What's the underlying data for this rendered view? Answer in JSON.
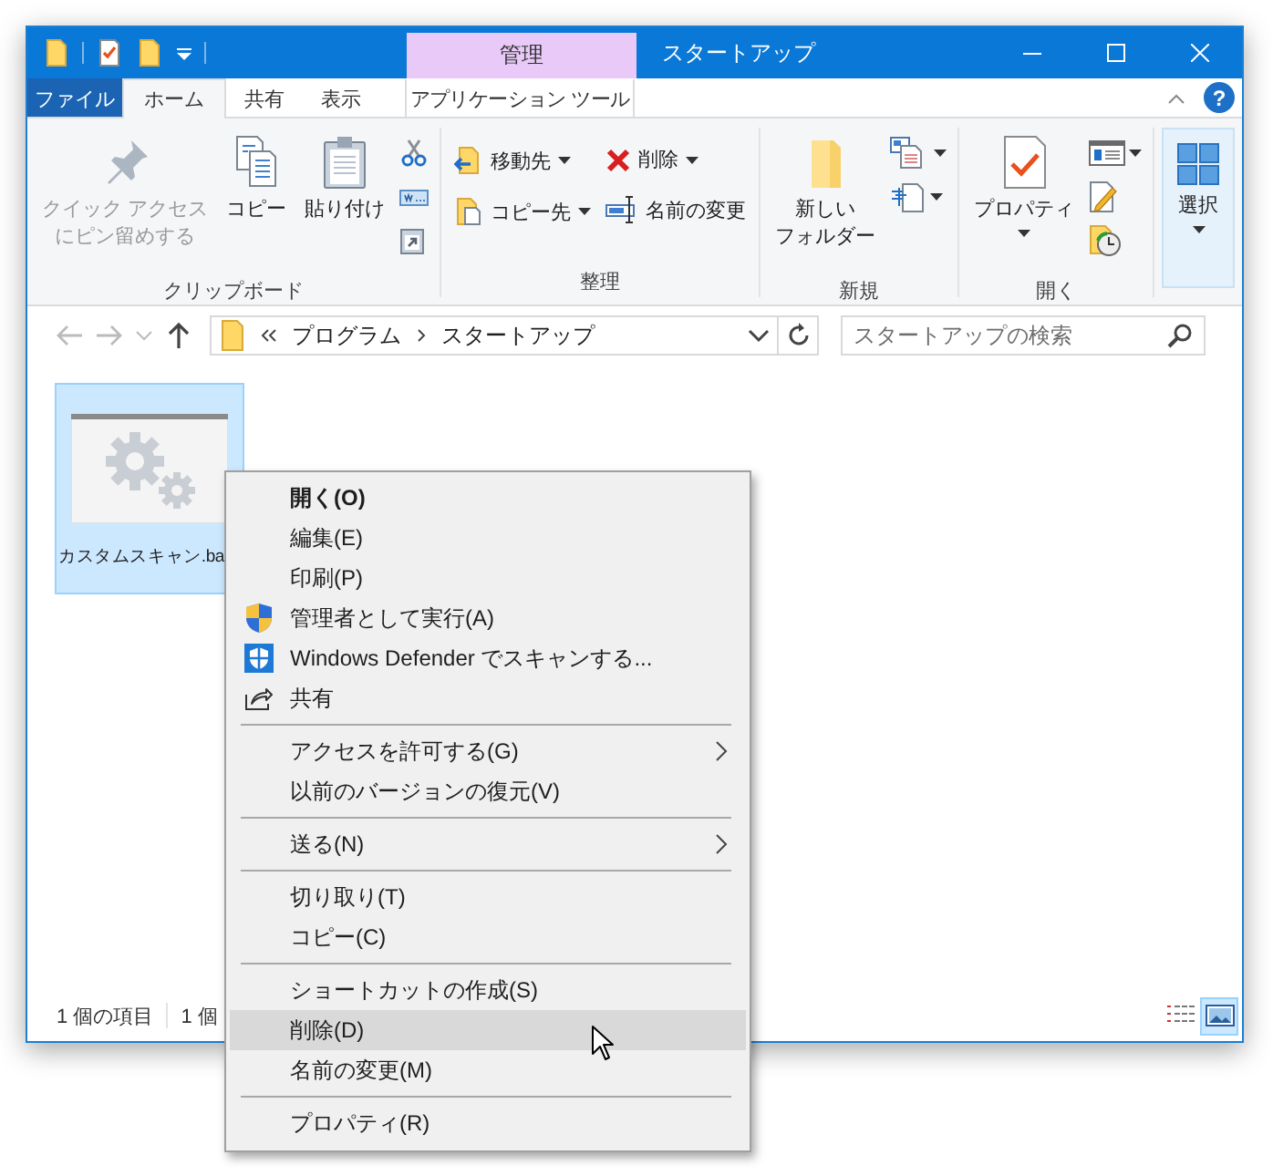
{
  "window": {
    "title": "スタートアップ",
    "context_tab_group": "管理",
    "help_button": "?"
  },
  "ribbon_tabs": [
    {
      "label": "ファイル",
      "kind": "file",
      "selected": false
    },
    {
      "label": "ホーム",
      "kind": "tab",
      "selected": true
    },
    {
      "label": "共有",
      "kind": "tab",
      "selected": false
    },
    {
      "label": "表示",
      "kind": "tab",
      "selected": false
    },
    {
      "label": "アプリケーション ツール",
      "kind": "context",
      "selected": false
    }
  ],
  "ribbon_groups": [
    {
      "label": "クリップボード",
      "columns": [
        [
          {
            "kind": "large",
            "lines": [
              "クイック アクセス",
              "にピン留めする"
            ],
            "disabled": true,
            "dropdown": false
          }
        ],
        [
          {
            "kind": "large",
            "lines": [
              "コピー"
            ],
            "disabled": false,
            "dropdown": false
          }
        ],
        [
          {
            "kind": "large",
            "lines": [
              "貼り付け"
            ],
            "disabled": false,
            "dropdown": false
          }
        ],
        [
          {
            "kind": "icon",
            "disabled": false,
            "dropdown": false
          },
          {
            "kind": "icon",
            "disabled": false,
            "dropdown": false
          },
          {
            "kind": "icon",
            "disabled": false,
            "dropdown": false
          }
        ]
      ]
    },
    {
      "label": "整理",
      "columns": [
        [
          {
            "kind": "small",
            "lines": [
              "移動先"
            ],
            "disabled": false,
            "dropdown": true
          },
          {
            "kind": "small",
            "lines": [
              "コピー先"
            ],
            "disabled": false,
            "dropdown": true
          }
        ],
        [
          {
            "kind": "small",
            "lines": [
              "削除"
            ],
            "disabled": false,
            "dropdown": true
          },
          {
            "kind": "small",
            "lines": [
              "名前の変更"
            ],
            "disabled": false,
            "dropdown": false
          }
        ]
      ]
    },
    {
      "label": "新規",
      "columns": [
        [
          {
            "kind": "large",
            "lines": [
              "新しい",
              "フォルダー"
            ],
            "disabled": false,
            "dropdown": false
          }
        ],
        [
          {
            "kind": "icon",
            "disabled": false,
            "dropdown": true
          },
          {
            "kind": "icon",
            "disabled": false,
            "dropdown": true
          }
        ]
      ]
    },
    {
      "label": "開く",
      "columns": [
        [
          {
            "kind": "large",
            "lines": [
              "プロパティ"
            ],
            "disabled": false,
            "dropdown": true
          }
        ],
        [
          {
            "kind": "icon",
            "disabled": false,
            "dropdown": true
          },
          {
            "kind": "icon",
            "disabled": false,
            "dropdown": false
          },
          {
            "kind": "icon",
            "disabled": false,
            "dropdown": false
          }
        ]
      ]
    },
    {
      "columns": [
        [
          {
            "kind": "collapsed",
            "lines": [
              "選択"
            ],
            "disabled": false,
            "dropdown": true
          }
        ]
      ]
    }
  ],
  "address": {
    "path": [
      "プログラム",
      "スタートアップ"
    ],
    "search_placeholder": "スタートアップの検索"
  },
  "files": [
    {
      "label": "カスタムスキャン.ba",
      "selected": true
    }
  ],
  "status_bar": {
    "item_count": "1 個の項目",
    "selection": "1 個"
  },
  "views": [
    {
      "kind": "details",
      "selected": false
    },
    {
      "kind": "large-icons",
      "selected": true
    }
  ],
  "context_menu": [
    {
      "kind": "item",
      "label": "開く(O)",
      "default": true,
      "submenu": false,
      "selected": false
    },
    {
      "kind": "item",
      "label": "編集(E)",
      "default": false,
      "submenu": false,
      "selected": false
    },
    {
      "kind": "item",
      "label": "印刷(P)",
      "default": false,
      "submenu": false,
      "selected": false
    },
    {
      "kind": "item",
      "label": "管理者として実行(A)",
      "default": false,
      "submenu": false,
      "selected": false
    },
    {
      "kind": "item",
      "label": "Windows Defender でスキャンする...",
      "default": false,
      "submenu": false,
      "selected": false
    },
    {
      "kind": "item",
      "label": "共有",
      "default": false,
      "submenu": false,
      "selected": false
    },
    {
      "kind": "separator"
    },
    {
      "kind": "item",
      "label": "アクセスを許可する(G)",
      "default": false,
      "submenu": true,
      "selected": false
    },
    {
      "kind": "item",
      "label": "以前のバージョンの復元(V)",
      "default": false,
      "submenu": false,
      "selected": false
    },
    {
      "kind": "separator"
    },
    {
      "kind": "item",
      "label": "送る(N)",
      "default": false,
      "submenu": true,
      "selected": false
    },
    {
      "kind": "separator"
    },
    {
      "kind": "item",
      "label": "切り取り(T)",
      "default": false,
      "submenu": false,
      "selected": false
    },
    {
      "kind": "item",
      "label": "コピー(C)",
      "default": false,
      "submenu": false,
      "selected": false
    },
    {
      "kind": "separator"
    },
    {
      "kind": "item",
      "label": "ショートカットの作成(S)",
      "default": false,
      "submenu": false,
      "selected": false
    },
    {
      "kind": "item",
      "label": "削除(D)",
      "default": false,
      "submenu": false,
      "selected": true
    },
    {
      "kind": "item",
      "label": "名前の変更(M)",
      "default": false,
      "submenu": false,
      "selected": false
    },
    {
      "kind": "separator"
    },
    {
      "kind": "item",
      "label": "プロパティ(R)",
      "default": false,
      "submenu": false,
      "selected": false
    }
  ]
}
